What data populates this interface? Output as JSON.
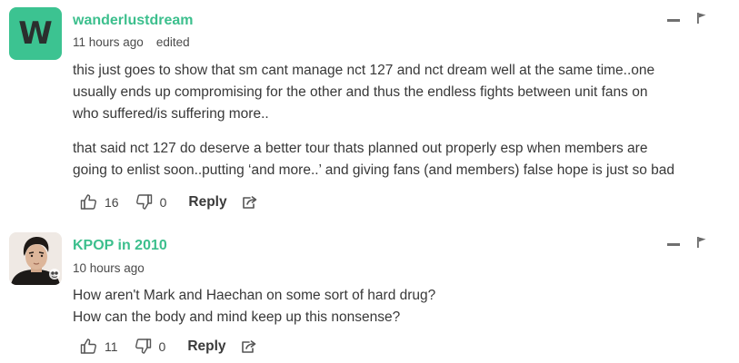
{
  "comments": [
    {
      "avatar_letter": "W",
      "avatar_color": "#3cc391",
      "username": "wanderlustdream",
      "time": "11 hours ago",
      "edited": "edited",
      "paragraphs": [
        "this just goes to show that sm cant manage nct 127 and nct dream well at the same time..one",
        "usually ends up compromising for the other and thus the endless fights between unit fans on",
        "who suffered/is suffering more..",
        "that said nct 127 do deserve a better tour thats planned out properly esp when members are",
        "going to enlist soon..putting ‘and more..’ and giving fans (and members) false hope is just so bad"
      ],
      "upvotes": "16",
      "downvotes": "0",
      "reply_label": "Reply"
    },
    {
      "avatar_icon": "profile-photo",
      "username": "KPOP in 2010",
      "time": "10 hours ago",
      "paragraphs": [
        "How aren't Mark and Haechan on some sort of hard drug?",
        "How can the body and mind keep up this nonsense?"
      ],
      "upvotes": "11",
      "downvotes": "0",
      "reply_label": "Reply"
    }
  ],
  "colors": {
    "accent": "#3cbf8d",
    "text": "#383838",
    "icon": "#707070"
  }
}
